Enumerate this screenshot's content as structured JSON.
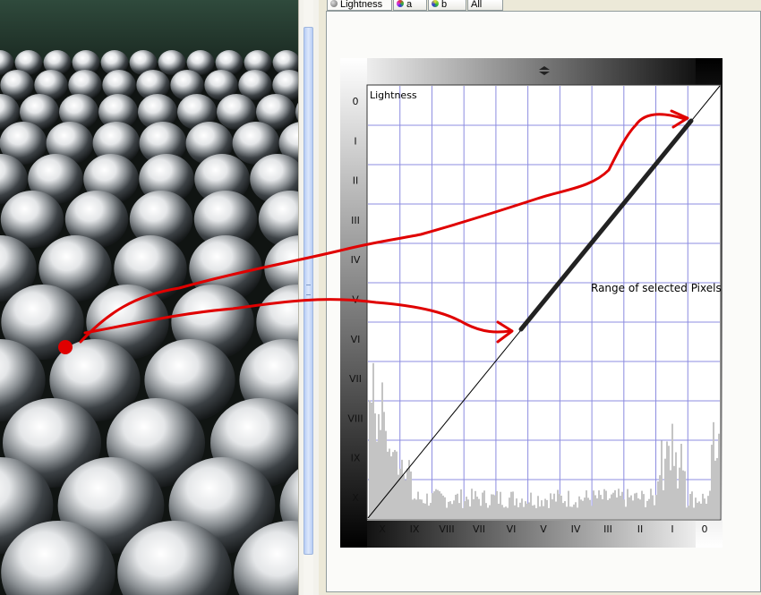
{
  "tabs": [
    {
      "label": "Lightness",
      "icon": "radio-dot-icon",
      "active": true
    },
    {
      "label": "a",
      "icon": "color-ball-icon"
    },
    {
      "label": "b",
      "icon": "color-ball-icon"
    },
    {
      "label": "All",
      "icon": ""
    }
  ],
  "curve": {
    "channel_label": "Lightness",
    "y_ticks": [
      "0",
      "I",
      "II",
      "III",
      "IV",
      "V",
      "VI",
      "VII",
      "VIII",
      "IX",
      "X"
    ],
    "x_ticks": [
      "X",
      "IX",
      "VIII",
      "VII",
      "VI",
      "V",
      "IV",
      "III",
      "II",
      "I",
      "0"
    ],
    "annotation": "Range of selected Pixels",
    "curve_handle_icon": "triangle-handle-icon"
  },
  "colors": {
    "grid_line": "#8c8ce0",
    "annotation_red": "#e00000",
    "histogram": "#c4c4c4"
  }
}
